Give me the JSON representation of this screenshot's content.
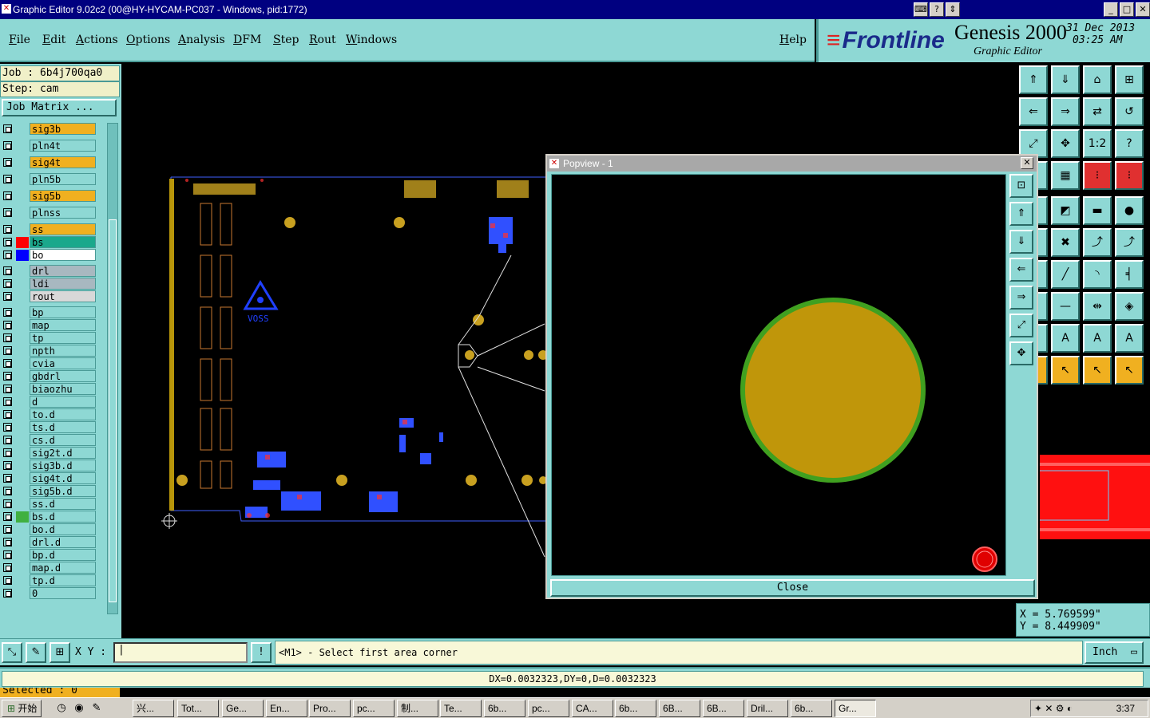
{
  "window": {
    "title": "Graphic Editor 9.02c2 (00@HY-HYCAM-PC037 - Windows, pid:1772)"
  },
  "menu": [
    "File",
    "Edit",
    "Actions",
    "Options",
    "Analysis",
    "DFM",
    "Step",
    "Rout",
    "Windows"
  ],
  "help_label": "Help",
  "brand": {
    "logo": "Frontline",
    "product": "Genesis 2000",
    "subtitle": "Graphic Editor",
    "date": "31 Dec 2013",
    "time": "03:25 AM"
  },
  "left": {
    "job": "Job : 6b4j700qa0",
    "step": "Step: cam",
    "job_matrix": "Job Matrix ...",
    "selected": "Selected : 0",
    "layers": [
      {
        "name": "sig3b",
        "bg": "#f0b020"
      },
      {
        "name": "pln4t",
        "bg": "#8ed8d4"
      },
      {
        "name": "sig4t",
        "bg": "#f0b020"
      },
      {
        "name": "pln5b",
        "bg": "#8ed8d4"
      },
      {
        "name": "sig5b",
        "bg": "#f0b020"
      },
      {
        "name": "plnss",
        "bg": "#8ed8d4"
      },
      {
        "name": "ss",
        "bg": "#f0b020"
      },
      {
        "name": "bs",
        "bg": "#1aa88c",
        "swatch": "#ff0000"
      },
      {
        "name": "bo",
        "bg": "#ffffff",
        "swatch": "#0000ff"
      },
      {
        "name": "drl",
        "bg": "#a8b8c0"
      },
      {
        "name": "ldi",
        "bg": "#a8b8c0"
      },
      {
        "name": "rout",
        "bg": "#d8d8d8"
      },
      {
        "name": "bp",
        "bg": "#8ed8d4"
      },
      {
        "name": "map",
        "bg": "#8ed8d4"
      },
      {
        "name": "tp",
        "bg": "#8ed8d4"
      },
      {
        "name": "npth",
        "bg": "#8ed8d4"
      },
      {
        "name": "cvia",
        "bg": "#8ed8d4"
      },
      {
        "name": "gbdrl",
        "bg": "#8ed8d4"
      },
      {
        "name": "biaozhu",
        "bg": "#8ed8d4"
      },
      {
        "name": "d",
        "bg": "#8ed8d4"
      },
      {
        "name": "to.d",
        "bg": "#8ed8d4"
      },
      {
        "name": "ts.d",
        "bg": "#8ed8d4"
      },
      {
        "name": "cs.d",
        "bg": "#8ed8d4"
      },
      {
        "name": "sig2t.d",
        "bg": "#8ed8d4"
      },
      {
        "name": "sig3b.d",
        "bg": "#8ed8d4"
      },
      {
        "name": "sig4t.d",
        "bg": "#8ed8d4"
      },
      {
        "name": "sig5b.d",
        "bg": "#8ed8d4"
      },
      {
        "name": "ss.d",
        "bg": "#8ed8d4"
      },
      {
        "name": "bs.d",
        "bg": "#8ed8d4",
        "swatch": "#40b040"
      },
      {
        "name": "bo.d",
        "bg": "#8ed8d4"
      },
      {
        "name": "drl.d",
        "bg": "#8ed8d4"
      },
      {
        "name": "bp.d",
        "bg": "#8ed8d4"
      },
      {
        "name": "map.d",
        "bg": "#8ed8d4"
      },
      {
        "name": "tp.d",
        "bg": "#8ed8d4"
      },
      {
        "name": "0",
        "bg": "#8ed8d4"
      }
    ]
  },
  "canvas": {
    "marker_text": "VOSS"
  },
  "popview": {
    "title": "Popview - 1",
    "close_label": "Close"
  },
  "coords": {
    "x": "X = 5.769599\"",
    "y": "Y = 8.449909\""
  },
  "cmd": {
    "xy_label": "X Y :",
    "message": "<M1> - Select first area corner",
    "unit": "Inch",
    "status": "DX=0.0032323,DY=0,D=0.0032323"
  },
  "taskbar": {
    "start": "开始",
    "tasks": [
      "兴...",
      "Tot...",
      "Ge...",
      "En...",
      "Pro...",
      "pc...",
      "制...",
      "Te...",
      "6b...",
      "pc...",
      "CA...",
      "6b...",
      "6B...",
      "6B...",
      "Dril...",
      "6b...",
      "Gr..."
    ],
    "clock": "3:37"
  }
}
